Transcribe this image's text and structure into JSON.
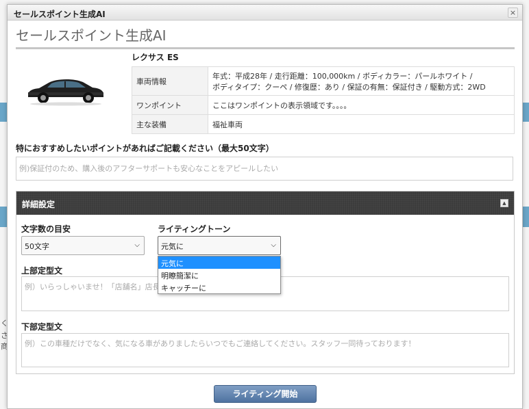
{
  "background": {
    "left_edge_texts": [
      "く",
      "さ",
      "商"
    ]
  },
  "dialog": {
    "window_title": "セールスポイント生成AI",
    "close_symbol": "×",
    "heading": "セールスポイント生成AI"
  },
  "vehicle": {
    "name": "レクサス ES",
    "info_rows": [
      {
        "label": "車両情報",
        "value_line1": "年式：平成28年 / 走行距離：100,000km / ボディカラー：パールホワイト /",
        "value_line2": "ボディタイプ：クーペ / 修復歴：あり / 保証の有無：保証付き / 駆動方式：2WD"
      },
      {
        "label": "ワンポイント",
        "value": "ここはワンポイントの表示領域です。。。。"
      },
      {
        "label": "主な装備",
        "value": "福祉車両"
      }
    ]
  },
  "recommend": {
    "label": "特におすすめしたいポイントがあればご記載ください（最大50文字）",
    "placeholder": "例)保証付のため、購入後のアフターサポートも安心なことをアピールしたい"
  },
  "settings": {
    "header": "詳細設定",
    "collapse_symbol": "▲",
    "char_count": {
      "label": "文字数の目安",
      "selected": "50文字"
    },
    "tone": {
      "label": "ライティングトーン",
      "selected": "元気に",
      "options": [
        "元気に",
        "明瞭簡潔に",
        "キャッチーに"
      ]
    },
    "header_text": {
      "label": "上部定型文",
      "placeholder": "例）いらっしゃいませ！「店舗名」店長"
    },
    "footer_text": {
      "label": "下部定型文",
      "placeholder": "例）この車種だけでなく、気になる車がありましたらいつでもご連絡してください。スタッフ一同待っております！"
    }
  },
  "actions": {
    "start_label": "ライティング開始"
  },
  "colors": {
    "header_bg": "#3b3b3b",
    "button_bg": "#5b7fae",
    "selected_option": "#1e90ff"
  }
}
